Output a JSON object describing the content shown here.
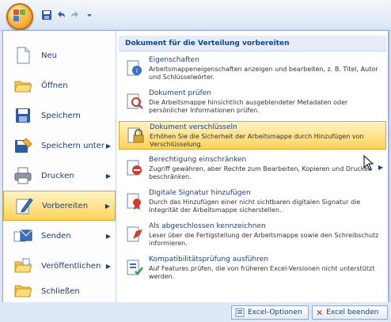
{
  "left_menu": [
    {
      "label": "Neu"
    },
    {
      "label": "Öffnen"
    },
    {
      "label": "Speichern"
    },
    {
      "label": "Speichern unter",
      "has_arrow": true
    },
    {
      "label": "Drucken",
      "has_arrow": true
    },
    {
      "label": "Vorbereiten",
      "has_arrow": true,
      "active": true
    },
    {
      "label": "Senden",
      "has_arrow": true
    },
    {
      "label": "Veröffentlichen",
      "has_arrow": true
    },
    {
      "label": "Schließen"
    }
  ],
  "submenu": {
    "header": "Dokument für die Verteilung vorbereiten",
    "items": [
      {
        "title": "Eigenschaften",
        "desc": "Arbeitsmappeneigenschaften anzeigen und bearbeiten, z. B. Titel, Autor und Schlüsselwörter."
      },
      {
        "title": "Dokument prüfen",
        "desc": "Die Arbeitsmappe hinsichtlich ausgeblendeter Metadaten oder persönlicher Informationen prüfen."
      },
      {
        "title": "Dokument verschlüsseln",
        "desc": "Erhöhen Sie die Sicherheit der Arbeitsmappe durch Hinzufügen von Verschlüsselung.",
        "active": true
      },
      {
        "title": "Berechtigung einschränken",
        "desc": "Zugriff gewähren, aber Rechte zum Bearbeiten, Kopieren und Drucken beschränken.",
        "has_arrow": true
      },
      {
        "title": "Digitale Signatur hinzufügen",
        "desc": "Durch das Hinzufügen einer nicht sichtbaren digitalen Signatur die Integrität der Arbeitsmappe sicherstellen."
      },
      {
        "title": "Als abgeschlossen kennzeichnen",
        "desc": "Leser über die Fertigstellung der Arbeitsmappe sowie den Schreibschutz informieren."
      },
      {
        "title": "Kompatibilitätsprüfung ausführen",
        "desc": "Auf Features prüfen, die von früheren Excel-Versionen nicht unterstützt werden."
      }
    ]
  },
  "bottom": {
    "options_label": "Excel-Optionen",
    "exit_label": "Excel beenden"
  }
}
